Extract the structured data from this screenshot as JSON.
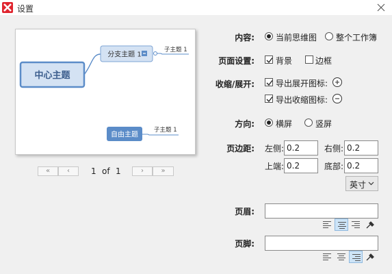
{
  "window": {
    "title": "设置"
  },
  "preview": {
    "central_topic": "中心主题",
    "subtopic": "分支主题 1",
    "child_topic_1": "子主题 1",
    "floating_topic": "自由主题",
    "child_topic_2": "子主题 1"
  },
  "pager": {
    "first": "«",
    "prev": "‹",
    "next": "›",
    "last": "»",
    "current": "1",
    "of": "of",
    "total": "1"
  },
  "content": {
    "label": "内容:",
    "options": [
      "当前思维图",
      "整个工作簿"
    ],
    "selected": "当前思维图"
  },
  "page_settings": {
    "label": "页面设置:",
    "background": "背景",
    "border": "边框",
    "background_checked": true,
    "border_checked": false
  },
  "collapse": {
    "label": "收缩/展开:",
    "expand_icon": "导出展开图标:",
    "collapse_icon": "导出收缩图标:",
    "expand_checked": true,
    "collapse_checked": true
  },
  "orientation": {
    "label": "方向:",
    "options": [
      "横屏",
      "竖屏"
    ],
    "selected": "横屏"
  },
  "margins": {
    "label": "页边距:",
    "left_label": "左侧:",
    "left": "0.2",
    "right_label": "右侧:",
    "right": "0.2",
    "top_label": "上端:",
    "top": "0.2",
    "bottom_label": "底部:",
    "bottom": "0.2",
    "unit": "英寸"
  },
  "header": {
    "label": "页眉:",
    "value": "",
    "alignment": "center"
  },
  "footer": {
    "label": "页脚:",
    "value": "",
    "alignment": "right"
  },
  "colors": {
    "central_fill": "#d4e2f3",
    "central_border": "#5b8cc8",
    "accent": "#5b8cc8",
    "floating_fill": "#5b8cc8"
  }
}
